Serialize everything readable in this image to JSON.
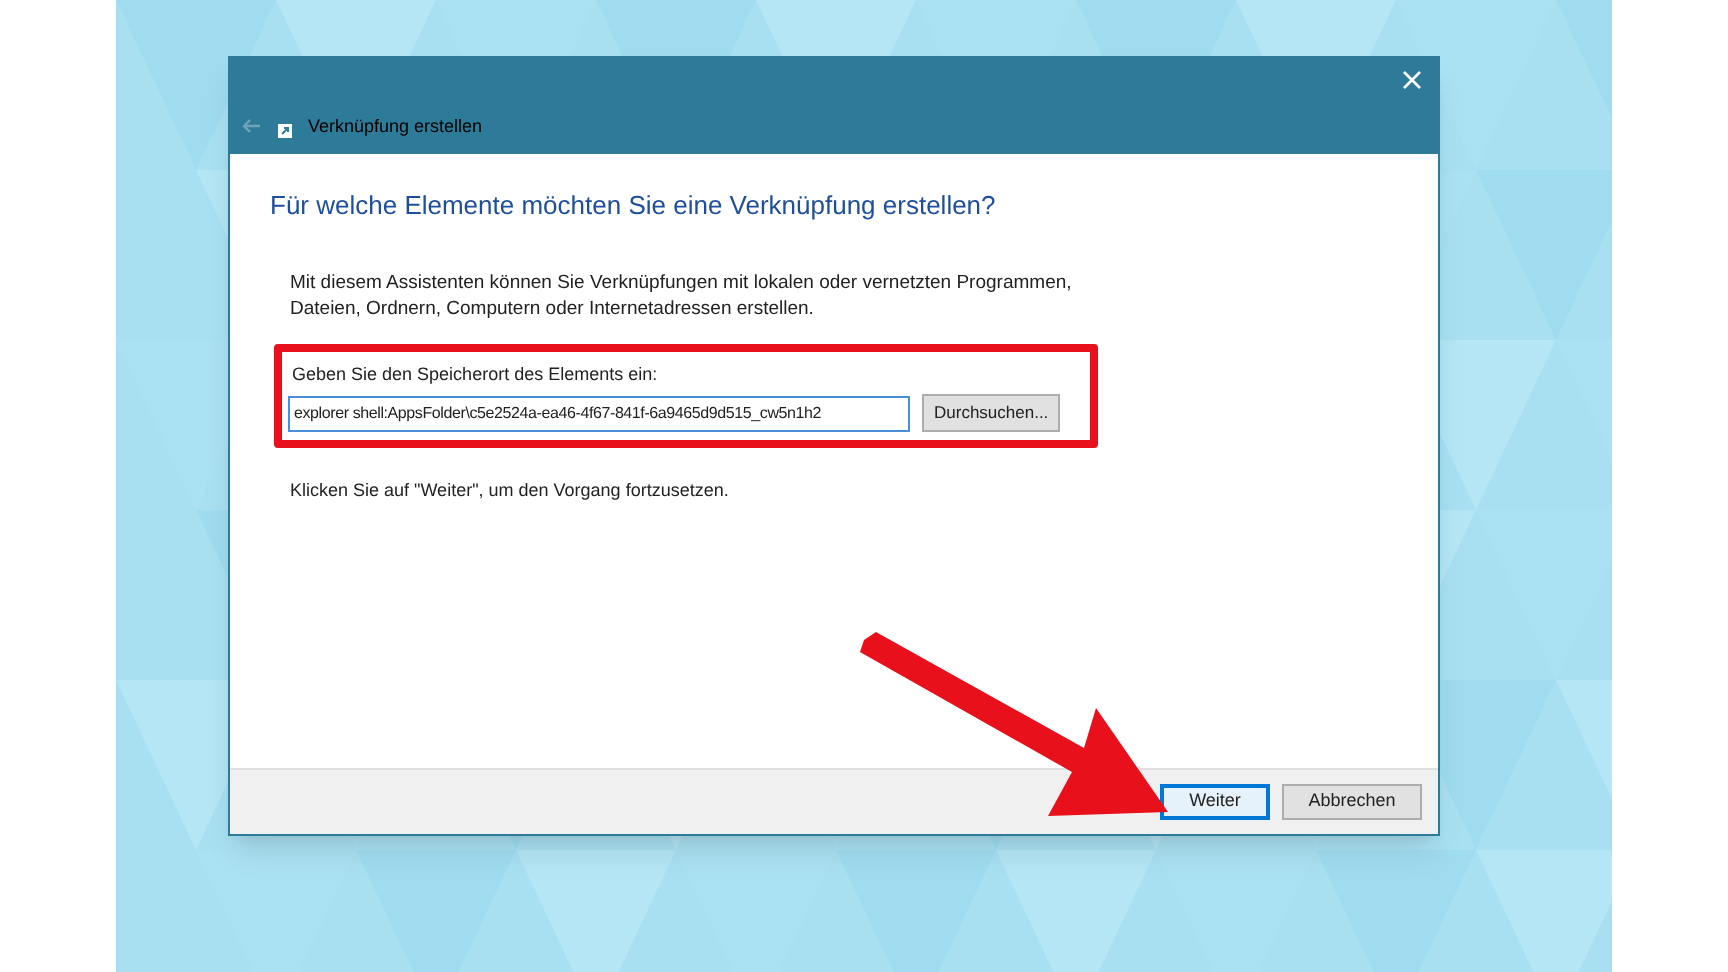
{
  "window": {
    "title": "Verknüpfung erstellen"
  },
  "heading": "Für welche Elemente möchten Sie eine Verknüpfung erstellen?",
  "description": "Mit diesem Assistenten können Sie Verknüpfungen mit lokalen oder vernetzten Programmen, Dateien, Ordnern, Computern oder Internetadressen erstellen.",
  "location": {
    "label": "Geben Sie den Speicherort des Elements ein:",
    "value": "explorer shell:AppsFolder\\c5e2524a-ea46-4f67-841f-6a9465d9d515_cw5n1h2",
    "browse_button": "Durchsuchen..."
  },
  "hint": "Klicken Sie auf \"Weiter\", um den Vorgang fortzusetzen.",
  "buttons": [
    {
      "label": "Weiter",
      "selected": true
    },
    {
      "label": "Abbrechen",
      "selected": false
    }
  ]
}
